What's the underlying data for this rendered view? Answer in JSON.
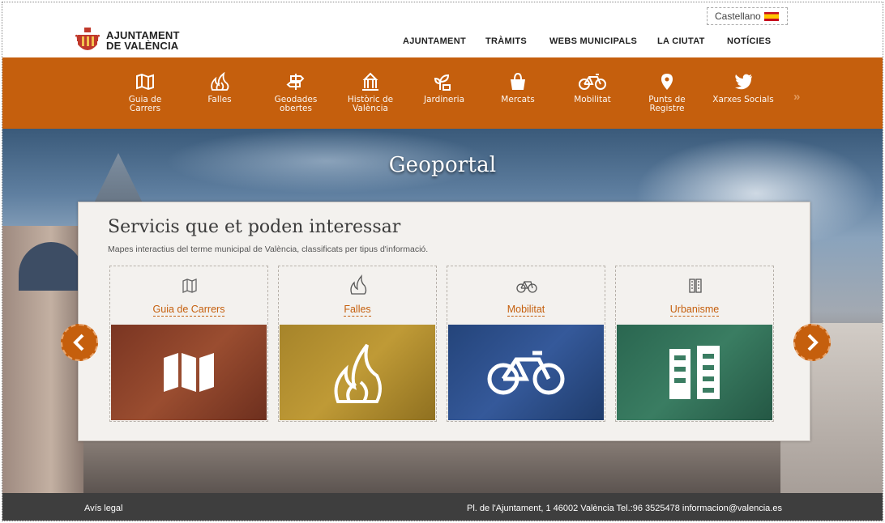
{
  "language": {
    "label": "Castellano"
  },
  "logo": {
    "line1": "AJUNTAMENT",
    "line2": "DE VALÈNCIA"
  },
  "main_nav": [
    "AJUNTAMENT",
    "TRÀMITS",
    "WEBS MUNICIPALS",
    "LA CIUTAT",
    "NOTÍCIES"
  ],
  "category_bar": {
    "items": [
      {
        "icon": "map-icon",
        "line1": "Guia de",
        "line2": "Carrers"
      },
      {
        "icon": "falles-icon",
        "line1": "Falles",
        "line2": ""
      },
      {
        "icon": "signpost-icon",
        "line1": "Geodades",
        "line2": "obertes"
      },
      {
        "icon": "monument-icon",
        "line1": "Històric de",
        "line2": "València"
      },
      {
        "icon": "plant-icon",
        "line1": "Jardineria",
        "line2": ""
      },
      {
        "icon": "shopping-bag-icon",
        "line1": "Mercats",
        "line2": ""
      },
      {
        "icon": "bicycle-icon",
        "line1": "Mobilitat",
        "line2": ""
      },
      {
        "icon": "map-pin-icon",
        "line1": "Punts de",
        "line2": "Registre"
      },
      {
        "icon": "twitter-bird-icon",
        "line1": "Xarxes Socials",
        "line2": ""
      }
    ],
    "more": "»"
  },
  "hero": {
    "title": "Geoportal"
  },
  "panel": {
    "title": "Servicis que et poden interessar",
    "subtitle": "Mapes interactius del terme municipal de València, classificats per tipus d'informació.",
    "cards": [
      {
        "label": "Guia de Carrers",
        "icon": "map-icon",
        "color": "#8a4026"
      },
      {
        "label": "Falles",
        "icon": "falles-icon",
        "color": "#b4922c"
      },
      {
        "label": "Mobilitat",
        "icon": "bicycle-icon",
        "color": "#2c4f86"
      },
      {
        "label": "Urbanisme",
        "icon": "buildings-icon",
        "color": "#2f6b54"
      }
    ]
  },
  "colors": {
    "accent": "#c55f0d",
    "footer": "#3e3e3e"
  },
  "footer": {
    "legal": "Avís legal",
    "address": "Pl. de l'Ajuntament, 1 46002 València Tel.:96 3525478 informacion@valencia.es"
  }
}
